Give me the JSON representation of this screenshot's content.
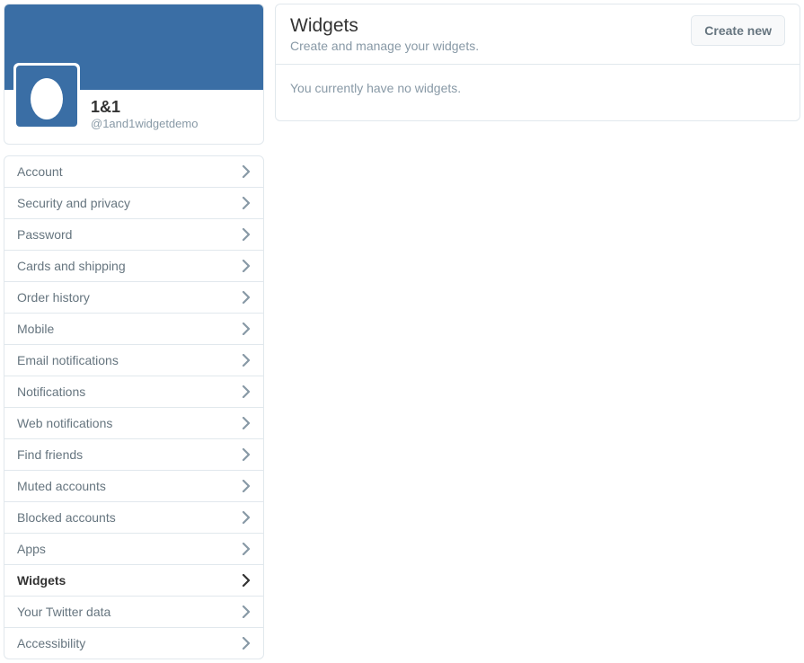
{
  "profile": {
    "name": "1&1",
    "handle": "@1and1widgetdemo"
  },
  "nav": {
    "items": [
      {
        "label": "Account",
        "active": false
      },
      {
        "label": "Security and privacy",
        "active": false
      },
      {
        "label": "Password",
        "active": false
      },
      {
        "label": "Cards and shipping",
        "active": false
      },
      {
        "label": "Order history",
        "active": false
      },
      {
        "label": "Mobile",
        "active": false
      },
      {
        "label": "Email notifications",
        "active": false
      },
      {
        "label": "Notifications",
        "active": false
      },
      {
        "label": "Web notifications",
        "active": false
      },
      {
        "label": "Find friends",
        "active": false
      },
      {
        "label": "Muted accounts",
        "active": false
      },
      {
        "label": "Blocked accounts",
        "active": false
      },
      {
        "label": "Apps",
        "active": false
      },
      {
        "label": "Widgets",
        "active": true
      },
      {
        "label": "Your Twitter data",
        "active": false
      },
      {
        "label": "Accessibility",
        "active": false
      }
    ]
  },
  "main": {
    "title": "Widgets",
    "subtitle": "Create and manage your widgets.",
    "create_button": "Create new",
    "empty_message": "You currently have no widgets."
  }
}
